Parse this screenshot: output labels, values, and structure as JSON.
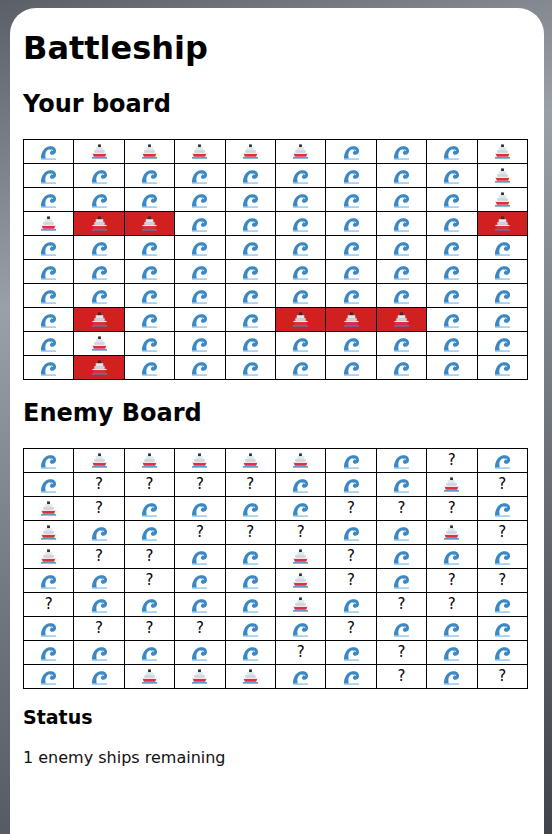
{
  "title": "Battleship",
  "your_board": {
    "heading": "Your board",
    "rows": [
      [
        {
          "kind": "water",
          "hit": false
        },
        {
          "kind": "ship",
          "hit": false
        },
        {
          "kind": "ship",
          "hit": false
        },
        {
          "kind": "ship",
          "hit": false
        },
        {
          "kind": "ship",
          "hit": false
        },
        {
          "kind": "ship",
          "hit": false
        },
        {
          "kind": "water",
          "hit": false
        },
        {
          "kind": "water",
          "hit": false
        },
        {
          "kind": "water",
          "hit": false
        },
        {
          "kind": "ship",
          "hit": false
        }
      ],
      [
        {
          "kind": "water",
          "hit": false
        },
        {
          "kind": "water",
          "hit": false
        },
        {
          "kind": "water",
          "hit": false
        },
        {
          "kind": "water",
          "hit": false
        },
        {
          "kind": "water",
          "hit": false
        },
        {
          "kind": "water",
          "hit": false
        },
        {
          "kind": "water",
          "hit": false
        },
        {
          "kind": "water",
          "hit": false
        },
        {
          "kind": "water",
          "hit": false
        },
        {
          "kind": "ship",
          "hit": false
        }
      ],
      [
        {
          "kind": "water",
          "hit": false
        },
        {
          "kind": "water",
          "hit": false
        },
        {
          "kind": "water",
          "hit": false
        },
        {
          "kind": "water",
          "hit": false
        },
        {
          "kind": "water",
          "hit": false
        },
        {
          "kind": "water",
          "hit": false
        },
        {
          "kind": "water",
          "hit": false
        },
        {
          "kind": "water",
          "hit": false
        },
        {
          "kind": "water",
          "hit": false
        },
        {
          "kind": "ship",
          "hit": false
        }
      ],
      [
        {
          "kind": "ship",
          "hit": false
        },
        {
          "kind": "ship",
          "hit": true
        },
        {
          "kind": "ship",
          "hit": true
        },
        {
          "kind": "water",
          "hit": false
        },
        {
          "kind": "water",
          "hit": false
        },
        {
          "kind": "water",
          "hit": false
        },
        {
          "kind": "water",
          "hit": false
        },
        {
          "kind": "water",
          "hit": false
        },
        {
          "kind": "water",
          "hit": false
        },
        {
          "kind": "ship",
          "hit": true
        }
      ],
      [
        {
          "kind": "water",
          "hit": false
        },
        {
          "kind": "water",
          "hit": false
        },
        {
          "kind": "water",
          "hit": false
        },
        {
          "kind": "water",
          "hit": false
        },
        {
          "kind": "water",
          "hit": false
        },
        {
          "kind": "water",
          "hit": false
        },
        {
          "kind": "water",
          "hit": false
        },
        {
          "kind": "water",
          "hit": false
        },
        {
          "kind": "water",
          "hit": false
        },
        {
          "kind": "water",
          "hit": false
        }
      ],
      [
        {
          "kind": "water",
          "hit": false
        },
        {
          "kind": "water",
          "hit": false
        },
        {
          "kind": "water",
          "hit": false
        },
        {
          "kind": "water",
          "hit": false
        },
        {
          "kind": "water",
          "hit": false
        },
        {
          "kind": "water",
          "hit": false
        },
        {
          "kind": "water",
          "hit": false
        },
        {
          "kind": "water",
          "hit": false
        },
        {
          "kind": "water",
          "hit": false
        },
        {
          "kind": "water",
          "hit": false
        }
      ],
      [
        {
          "kind": "water",
          "hit": false
        },
        {
          "kind": "water",
          "hit": false
        },
        {
          "kind": "water",
          "hit": false
        },
        {
          "kind": "water",
          "hit": false
        },
        {
          "kind": "water",
          "hit": false
        },
        {
          "kind": "water",
          "hit": false
        },
        {
          "kind": "water",
          "hit": false
        },
        {
          "kind": "water",
          "hit": false
        },
        {
          "kind": "water",
          "hit": false
        },
        {
          "kind": "water",
          "hit": false
        }
      ],
      [
        {
          "kind": "water",
          "hit": false
        },
        {
          "kind": "ship",
          "hit": true
        },
        {
          "kind": "water",
          "hit": false
        },
        {
          "kind": "water",
          "hit": false
        },
        {
          "kind": "water",
          "hit": false
        },
        {
          "kind": "ship",
          "hit": true
        },
        {
          "kind": "ship",
          "hit": true
        },
        {
          "kind": "ship",
          "hit": true
        },
        {
          "kind": "water",
          "hit": false
        },
        {
          "kind": "water",
          "hit": false
        }
      ],
      [
        {
          "kind": "water",
          "hit": false
        },
        {
          "kind": "ship",
          "hit": false
        },
        {
          "kind": "water",
          "hit": false
        },
        {
          "kind": "water",
          "hit": false
        },
        {
          "kind": "water",
          "hit": false
        },
        {
          "kind": "water",
          "hit": false
        },
        {
          "kind": "water",
          "hit": false
        },
        {
          "kind": "water",
          "hit": false
        },
        {
          "kind": "water",
          "hit": false
        },
        {
          "kind": "water",
          "hit": false
        }
      ],
      [
        {
          "kind": "water",
          "hit": false
        },
        {
          "kind": "ship",
          "hit": true
        },
        {
          "kind": "water",
          "hit": false
        },
        {
          "kind": "water",
          "hit": false
        },
        {
          "kind": "water",
          "hit": false
        },
        {
          "kind": "water",
          "hit": false
        },
        {
          "kind": "water",
          "hit": false
        },
        {
          "kind": "water",
          "hit": false
        },
        {
          "kind": "water",
          "hit": false
        },
        {
          "kind": "water",
          "hit": false
        }
      ]
    ]
  },
  "enemy_board": {
    "heading": "Enemy Board",
    "rows": [
      [
        {
          "kind": "water"
        },
        {
          "kind": "ship"
        },
        {
          "kind": "ship"
        },
        {
          "kind": "ship"
        },
        {
          "kind": "ship"
        },
        {
          "kind": "ship"
        },
        {
          "kind": "water"
        },
        {
          "kind": "water"
        },
        {
          "kind": "unknown",
          "label": "?"
        },
        {
          "kind": "water"
        }
      ],
      [
        {
          "kind": "water"
        },
        {
          "kind": "unknown",
          "label": "?"
        },
        {
          "kind": "unknown",
          "label": "?"
        },
        {
          "kind": "unknown",
          "label": "?"
        },
        {
          "kind": "unknown",
          "label": "?"
        },
        {
          "kind": "water"
        },
        {
          "kind": "water"
        },
        {
          "kind": "water"
        },
        {
          "kind": "ship"
        },
        {
          "kind": "unknown",
          "label": "?"
        }
      ],
      [
        {
          "kind": "ship"
        },
        {
          "kind": "unknown",
          "label": "?"
        },
        {
          "kind": "water"
        },
        {
          "kind": "water"
        },
        {
          "kind": "water"
        },
        {
          "kind": "water"
        },
        {
          "kind": "unknown",
          "label": "?"
        },
        {
          "kind": "unknown",
          "label": "?"
        },
        {
          "kind": "unknown",
          "label": "?"
        },
        {
          "kind": "water"
        }
      ],
      [
        {
          "kind": "ship"
        },
        {
          "kind": "water"
        },
        {
          "kind": "water"
        },
        {
          "kind": "unknown",
          "label": "?"
        },
        {
          "kind": "unknown",
          "label": "?"
        },
        {
          "kind": "unknown",
          "label": "?"
        },
        {
          "kind": "water"
        },
        {
          "kind": "water"
        },
        {
          "kind": "ship"
        },
        {
          "kind": "unknown",
          "label": "?"
        }
      ],
      [
        {
          "kind": "ship"
        },
        {
          "kind": "unknown",
          "label": "?"
        },
        {
          "kind": "unknown",
          "label": "?"
        },
        {
          "kind": "water"
        },
        {
          "kind": "water"
        },
        {
          "kind": "ship"
        },
        {
          "kind": "unknown",
          "label": "?"
        },
        {
          "kind": "water"
        },
        {
          "kind": "water"
        },
        {
          "kind": "water"
        }
      ],
      [
        {
          "kind": "water"
        },
        {
          "kind": "water"
        },
        {
          "kind": "unknown",
          "label": "?"
        },
        {
          "kind": "water"
        },
        {
          "kind": "water"
        },
        {
          "kind": "ship"
        },
        {
          "kind": "unknown",
          "label": "?"
        },
        {
          "kind": "water"
        },
        {
          "kind": "unknown",
          "label": "?"
        },
        {
          "kind": "unknown",
          "label": "?"
        }
      ],
      [
        {
          "kind": "unknown",
          "label": "?"
        },
        {
          "kind": "water"
        },
        {
          "kind": "water"
        },
        {
          "kind": "water"
        },
        {
          "kind": "water"
        },
        {
          "kind": "ship"
        },
        {
          "kind": "water"
        },
        {
          "kind": "unknown",
          "label": "?"
        },
        {
          "kind": "unknown",
          "label": "?"
        },
        {
          "kind": "water"
        }
      ],
      [
        {
          "kind": "water"
        },
        {
          "kind": "unknown",
          "label": "?"
        },
        {
          "kind": "unknown",
          "label": "?"
        },
        {
          "kind": "unknown",
          "label": "?"
        },
        {
          "kind": "water"
        },
        {
          "kind": "water"
        },
        {
          "kind": "unknown",
          "label": "?"
        },
        {
          "kind": "water"
        },
        {
          "kind": "water"
        },
        {
          "kind": "water"
        }
      ],
      [
        {
          "kind": "water"
        },
        {
          "kind": "water"
        },
        {
          "kind": "water"
        },
        {
          "kind": "water"
        },
        {
          "kind": "water"
        },
        {
          "kind": "unknown",
          "label": "?"
        },
        {
          "kind": "water"
        },
        {
          "kind": "unknown",
          "label": "?"
        },
        {
          "kind": "water"
        },
        {
          "kind": "water"
        }
      ],
      [
        {
          "kind": "water"
        },
        {
          "kind": "water"
        },
        {
          "kind": "ship"
        },
        {
          "kind": "ship"
        },
        {
          "kind": "ship"
        },
        {
          "kind": "water"
        },
        {
          "kind": "water"
        },
        {
          "kind": "unknown",
          "label": "?"
        },
        {
          "kind": "water"
        },
        {
          "kind": "unknown",
          "label": "?"
        }
      ]
    ]
  },
  "status": {
    "heading": "Status",
    "message": "1 enemy ships remaining"
  }
}
